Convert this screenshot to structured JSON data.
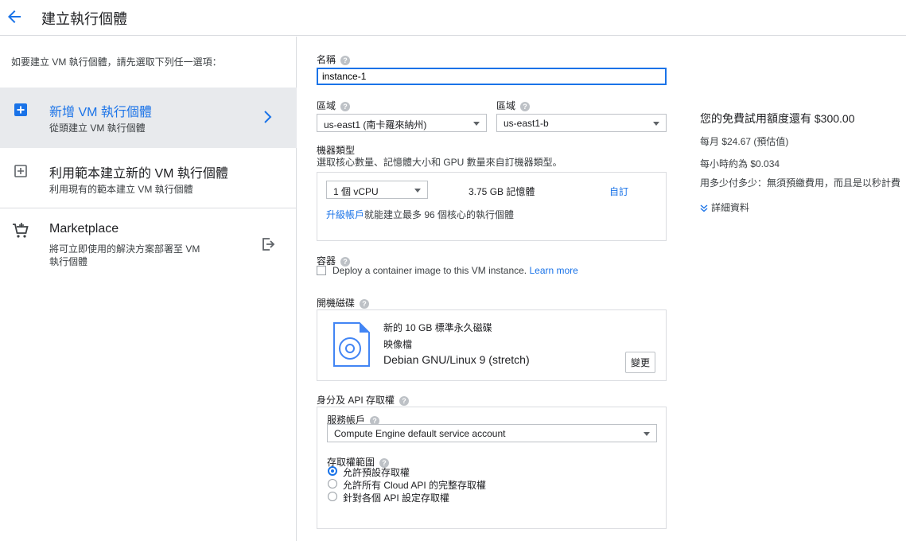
{
  "header": {
    "title": "建立執行個體"
  },
  "left": {
    "intro": "如要建立 VM 執行個體，請先選取下列任一選項：",
    "options": [
      {
        "title": "新增 VM 執行個體",
        "desc": "從頭建立 VM 執行個體",
        "icon": "add-box-icon",
        "selected": true
      },
      {
        "title": "利用範本建立新的 VM 執行個體",
        "desc": "利用現有的範本建立 VM 執行個體",
        "icon": "template-add-icon",
        "selected": false
      },
      {
        "title": "Marketplace",
        "desc": "將可立即使用的解決方案部署至 VM 執行個體",
        "icon": "cart-icon",
        "selected": false
      }
    ]
  },
  "form": {
    "name_label": "名稱",
    "name_value": "instance-1",
    "region_label": "區域",
    "region_value": "us-east1 (南卡羅來納州)",
    "zone_label": "區域",
    "zone_value": "us-east1-b",
    "machine_label": "機器類型",
    "machine_desc": "選取核心數量、記憶體大小和 GPU 數量來自訂機器類型。",
    "cpu_value": "1 個 vCPU",
    "memory": "3.75 GB 記憶體",
    "customize": "自訂",
    "upgrade_link": "升級帳戶",
    "upgrade_text": "就能建立最多 96 個核心的執行個體",
    "container_label": "容器",
    "container_text": "Deploy a container image to this VM instance.",
    "learn_more": "Learn more",
    "boot_label": "開機磁碟",
    "boot_line1": "新的 10 GB 標準永久磁碟",
    "boot_line2": "映像檔",
    "boot_image": "Debian GNU/Linux 9 (stretch)",
    "change": "變更",
    "identity_label": "身分及 API 存取權",
    "service_label": "服務帳戶",
    "service_value": "Compute Engine default service account",
    "scope_label": "存取權範圍",
    "scopes": [
      {
        "label": "允許預設存取權",
        "checked": true
      },
      {
        "label": "允許所有 Cloud API 的完整存取權",
        "checked": false
      },
      {
        "label": "針對各個 API 設定存取權",
        "checked": false
      }
    ]
  },
  "summary": {
    "trial": "您的免費試用額度還有 $300.00",
    "monthly": "每月 $24.67 (預估值)",
    "hourly": "每小時約為 $0.034",
    "billing": "用多少付多少：無須預繳費用，而且是以秒計費",
    "details": "詳細資料"
  },
  "colors": {
    "accent": "#1a73e8",
    "selected_bg": "#e8eaed"
  }
}
